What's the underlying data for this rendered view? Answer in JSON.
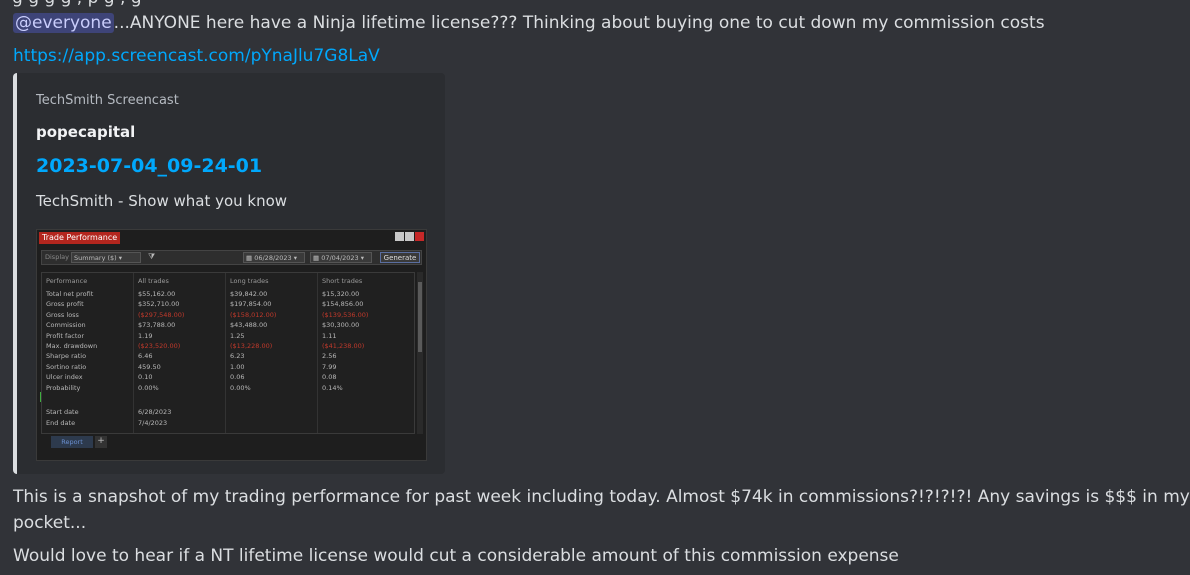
{
  "message": {
    "top_fragment": "g  g  g     g                 ,                          p                        g                  ,                      g",
    "mention": "@everyone",
    "line1_text": "...ANYONE here have a Ninja lifetime license???  Thinking about buying one to cut down my commission costs",
    "link": "https://app.screencast.com/pYnaJlu7G8LaV",
    "para1_line1": "This is a snapshot of my trading performance for past week including today.  Almost $74k in commissions?!?!?!?!  Any savings is $$$ in my",
    "para1_line2": "pocket...",
    "para2": "Would love to hear if a NT lifetime license would cut a considerable amount of this commission expense"
  },
  "embed": {
    "provider": "TechSmith Screencast",
    "author": "popecapital",
    "title": "2023-07-04_09-24-01",
    "description": "TechSmith - Show what you know",
    "border_color": "#dbdee1"
  },
  "screenshot": {
    "window_title": "Trade Performance",
    "display_label": "Display",
    "display_value": "Summary ($)",
    "filter_icon": "funnel-icon",
    "date_from": "06/28/2023",
    "date_to": "07/04/2023",
    "generate_label": "Generate",
    "headers": [
      "Performance",
      "All trades",
      "Long trades",
      "Short trades"
    ],
    "rows": [
      {
        "label": "Total net profit",
        "all": "$55,162.00",
        "long": "$39,842.00",
        "short": "$15,320.00"
      },
      {
        "label": "Gross profit",
        "all": "$352,710.00",
        "long": "$197,854.00",
        "short": "$154,856.00"
      },
      {
        "label": "Gross loss",
        "all": "($297,548.00)",
        "long": "($158,012.00)",
        "short": "($139,536.00)"
      },
      {
        "label": "Commission",
        "all": "$73,788.00",
        "long": "$43,488.00",
        "short": "$30,300.00"
      },
      {
        "label": "Profit factor",
        "all": "1.19",
        "long": "1.25",
        "short": "1.11"
      },
      {
        "label": "Max. drawdown",
        "all": "($23,520.00)",
        "long": "($13,228.00)",
        "short": "($41,238.00)"
      },
      {
        "label": "Sharpe ratio",
        "all": "6.46",
        "long": "6.23",
        "short": "2.56"
      },
      {
        "label": "Sortino ratio",
        "all": "459.50",
        "long": "1.00",
        "short": "7.99"
      },
      {
        "label": "Ulcer index",
        "all": "0.10",
        "long": "0.06",
        "short": "0.08"
      },
      {
        "label": "Probability",
        "all": "0.00%",
        "long": "0.00%",
        "short": "0.14%"
      }
    ],
    "start_date_label": "Start date",
    "start_date": "6/28/2023",
    "end_date_label": "End date",
    "end_date": "7/4/2023",
    "tab_report": "Report",
    "tab_add": "+"
  }
}
